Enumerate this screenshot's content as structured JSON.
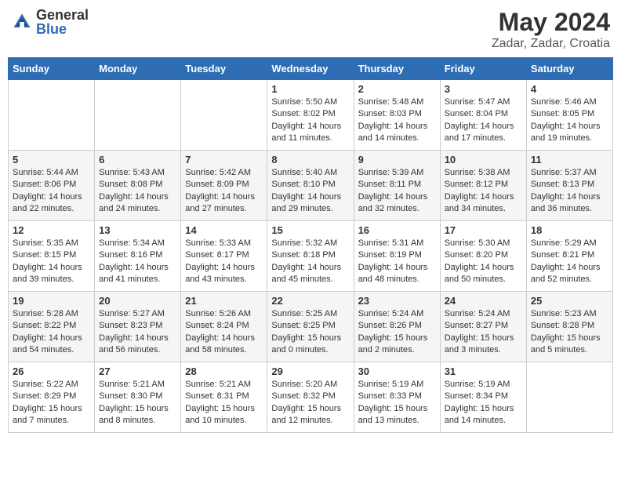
{
  "header": {
    "logo_general": "General",
    "logo_blue": "Blue",
    "month_title": "May 2024",
    "location": "Zadar, Zadar, Croatia"
  },
  "weekdays": [
    "Sunday",
    "Monday",
    "Tuesday",
    "Wednesday",
    "Thursday",
    "Friday",
    "Saturday"
  ],
  "weeks": [
    [
      {
        "day": "",
        "info": ""
      },
      {
        "day": "",
        "info": ""
      },
      {
        "day": "",
        "info": ""
      },
      {
        "day": "1",
        "info": "Sunrise: 5:50 AM\nSunset: 8:02 PM\nDaylight: 14 hours\nand 11 minutes."
      },
      {
        "day": "2",
        "info": "Sunrise: 5:48 AM\nSunset: 8:03 PM\nDaylight: 14 hours\nand 14 minutes."
      },
      {
        "day": "3",
        "info": "Sunrise: 5:47 AM\nSunset: 8:04 PM\nDaylight: 14 hours\nand 17 minutes."
      },
      {
        "day": "4",
        "info": "Sunrise: 5:46 AM\nSunset: 8:05 PM\nDaylight: 14 hours\nand 19 minutes."
      }
    ],
    [
      {
        "day": "5",
        "info": "Sunrise: 5:44 AM\nSunset: 8:06 PM\nDaylight: 14 hours\nand 22 minutes."
      },
      {
        "day": "6",
        "info": "Sunrise: 5:43 AM\nSunset: 8:08 PM\nDaylight: 14 hours\nand 24 minutes."
      },
      {
        "day": "7",
        "info": "Sunrise: 5:42 AM\nSunset: 8:09 PM\nDaylight: 14 hours\nand 27 minutes."
      },
      {
        "day": "8",
        "info": "Sunrise: 5:40 AM\nSunset: 8:10 PM\nDaylight: 14 hours\nand 29 minutes."
      },
      {
        "day": "9",
        "info": "Sunrise: 5:39 AM\nSunset: 8:11 PM\nDaylight: 14 hours\nand 32 minutes."
      },
      {
        "day": "10",
        "info": "Sunrise: 5:38 AM\nSunset: 8:12 PM\nDaylight: 14 hours\nand 34 minutes."
      },
      {
        "day": "11",
        "info": "Sunrise: 5:37 AM\nSunset: 8:13 PM\nDaylight: 14 hours\nand 36 minutes."
      }
    ],
    [
      {
        "day": "12",
        "info": "Sunrise: 5:35 AM\nSunset: 8:15 PM\nDaylight: 14 hours\nand 39 minutes."
      },
      {
        "day": "13",
        "info": "Sunrise: 5:34 AM\nSunset: 8:16 PM\nDaylight: 14 hours\nand 41 minutes."
      },
      {
        "day": "14",
        "info": "Sunrise: 5:33 AM\nSunset: 8:17 PM\nDaylight: 14 hours\nand 43 minutes."
      },
      {
        "day": "15",
        "info": "Sunrise: 5:32 AM\nSunset: 8:18 PM\nDaylight: 14 hours\nand 45 minutes."
      },
      {
        "day": "16",
        "info": "Sunrise: 5:31 AM\nSunset: 8:19 PM\nDaylight: 14 hours\nand 48 minutes."
      },
      {
        "day": "17",
        "info": "Sunrise: 5:30 AM\nSunset: 8:20 PM\nDaylight: 14 hours\nand 50 minutes."
      },
      {
        "day": "18",
        "info": "Sunrise: 5:29 AM\nSunset: 8:21 PM\nDaylight: 14 hours\nand 52 minutes."
      }
    ],
    [
      {
        "day": "19",
        "info": "Sunrise: 5:28 AM\nSunset: 8:22 PM\nDaylight: 14 hours\nand 54 minutes."
      },
      {
        "day": "20",
        "info": "Sunrise: 5:27 AM\nSunset: 8:23 PM\nDaylight: 14 hours\nand 56 minutes."
      },
      {
        "day": "21",
        "info": "Sunrise: 5:26 AM\nSunset: 8:24 PM\nDaylight: 14 hours\nand 58 minutes."
      },
      {
        "day": "22",
        "info": "Sunrise: 5:25 AM\nSunset: 8:25 PM\nDaylight: 15 hours\nand 0 minutes."
      },
      {
        "day": "23",
        "info": "Sunrise: 5:24 AM\nSunset: 8:26 PM\nDaylight: 15 hours\nand 2 minutes."
      },
      {
        "day": "24",
        "info": "Sunrise: 5:24 AM\nSunset: 8:27 PM\nDaylight: 15 hours\nand 3 minutes."
      },
      {
        "day": "25",
        "info": "Sunrise: 5:23 AM\nSunset: 8:28 PM\nDaylight: 15 hours\nand 5 minutes."
      }
    ],
    [
      {
        "day": "26",
        "info": "Sunrise: 5:22 AM\nSunset: 8:29 PM\nDaylight: 15 hours\nand 7 minutes."
      },
      {
        "day": "27",
        "info": "Sunrise: 5:21 AM\nSunset: 8:30 PM\nDaylight: 15 hours\nand 8 minutes."
      },
      {
        "day": "28",
        "info": "Sunrise: 5:21 AM\nSunset: 8:31 PM\nDaylight: 15 hours\nand 10 minutes."
      },
      {
        "day": "29",
        "info": "Sunrise: 5:20 AM\nSunset: 8:32 PM\nDaylight: 15 hours\nand 12 minutes."
      },
      {
        "day": "30",
        "info": "Sunrise: 5:19 AM\nSunset: 8:33 PM\nDaylight: 15 hours\nand 13 minutes."
      },
      {
        "day": "31",
        "info": "Sunrise: 5:19 AM\nSunset: 8:34 PM\nDaylight: 15 hours\nand 14 minutes."
      },
      {
        "day": "",
        "info": ""
      }
    ]
  ]
}
